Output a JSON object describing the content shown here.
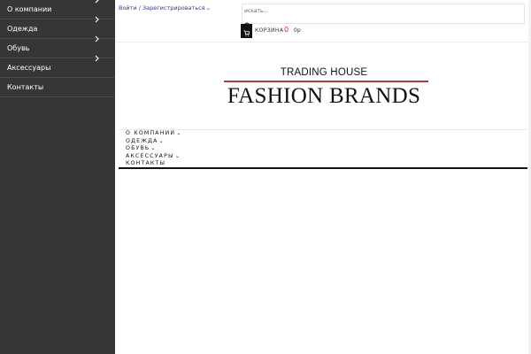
{
  "sidebar": {
    "items": [
      {
        "label": "О компании",
        "has_submenu": true
      },
      {
        "label": "Одежда",
        "has_submenu": true
      },
      {
        "label": "Обувь",
        "has_submenu": true
      },
      {
        "label": "Аксессуары",
        "has_submenu": true
      },
      {
        "label": "Контакты",
        "has_submenu": false
      }
    ]
  },
  "header": {
    "login_text": "Войти / Зарегистрироваться",
    "login_caret": "⌄",
    "search": {
      "placeholder": "искать..."
    },
    "cart": {
      "label": "КОРЗИНА",
      "count": "0",
      "price": "0р",
      "icon": "cart-icon"
    }
  },
  "logo": {
    "top_text": "TRADING HOUSE",
    "main_text": "FASHION BRANDS"
  },
  "main_menu": {
    "items": [
      {
        "label": "О КОМПАНИИ",
        "caret": "⌄"
      },
      {
        "label": "ОДЕЖДА",
        "caret": "⌄"
      },
      {
        "label": "ОБУВЬ",
        "caret": "⌄"
      },
      {
        "label": "АКСЕССУАРЫ",
        "caret": "⌄"
      },
      {
        "label": "КОНТАКТЫ",
        "caret": ""
      }
    ]
  },
  "colors": {
    "sidebar_bg": "#363636",
    "accent_red": "#c1272d",
    "link_blue": "#2f3b9a",
    "logo_line": "#b03a2e"
  }
}
